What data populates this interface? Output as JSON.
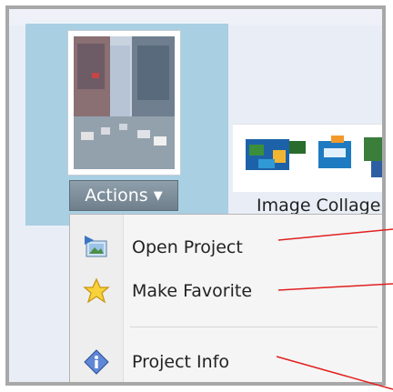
{
  "actions_button": {
    "label": "Actions",
    "arrow": "▼"
  },
  "collage": {
    "label": "Image Collage"
  },
  "menu": {
    "items": [
      {
        "label": "Open Project",
        "icon": "open-project-icon"
      },
      {
        "label": "Make Favorite",
        "icon": "star-icon"
      },
      {
        "label": "Project Info",
        "icon": "info-icon"
      }
    ]
  },
  "colors": {
    "panel": "#a9cfe3",
    "button": "#7a8b97",
    "callout_line": "#e02020"
  }
}
